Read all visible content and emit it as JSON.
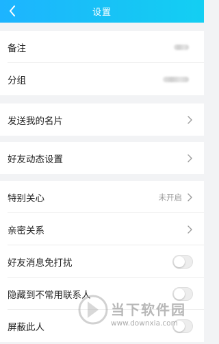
{
  "header": {
    "title": "设置",
    "back_icon": "chevron-left-icon"
  },
  "group1": {
    "rows": [
      {
        "label": "备注"
      },
      {
        "label": "分组"
      }
    ]
  },
  "group2": {
    "rows": [
      {
        "label": "发送我的名片"
      }
    ]
  },
  "group3": {
    "rows": [
      {
        "label": "好友动态设置"
      }
    ]
  },
  "group4": {
    "rows": [
      {
        "label": "特别关心",
        "value": "未开启"
      },
      {
        "label": "亲密关系"
      },
      {
        "label": "好友消息免打扰",
        "toggle": false
      },
      {
        "label": "隐藏到不常用联系人",
        "toggle": false
      },
      {
        "label": "屏蔽此人",
        "toggle": false
      }
    ]
  },
  "watermark": {
    "brand": "当下软件园",
    "url": "www.downxia.com"
  },
  "colors": {
    "header_start": "#1db4ff",
    "header_end": "#13cff3",
    "background": "#f2f3f5"
  }
}
